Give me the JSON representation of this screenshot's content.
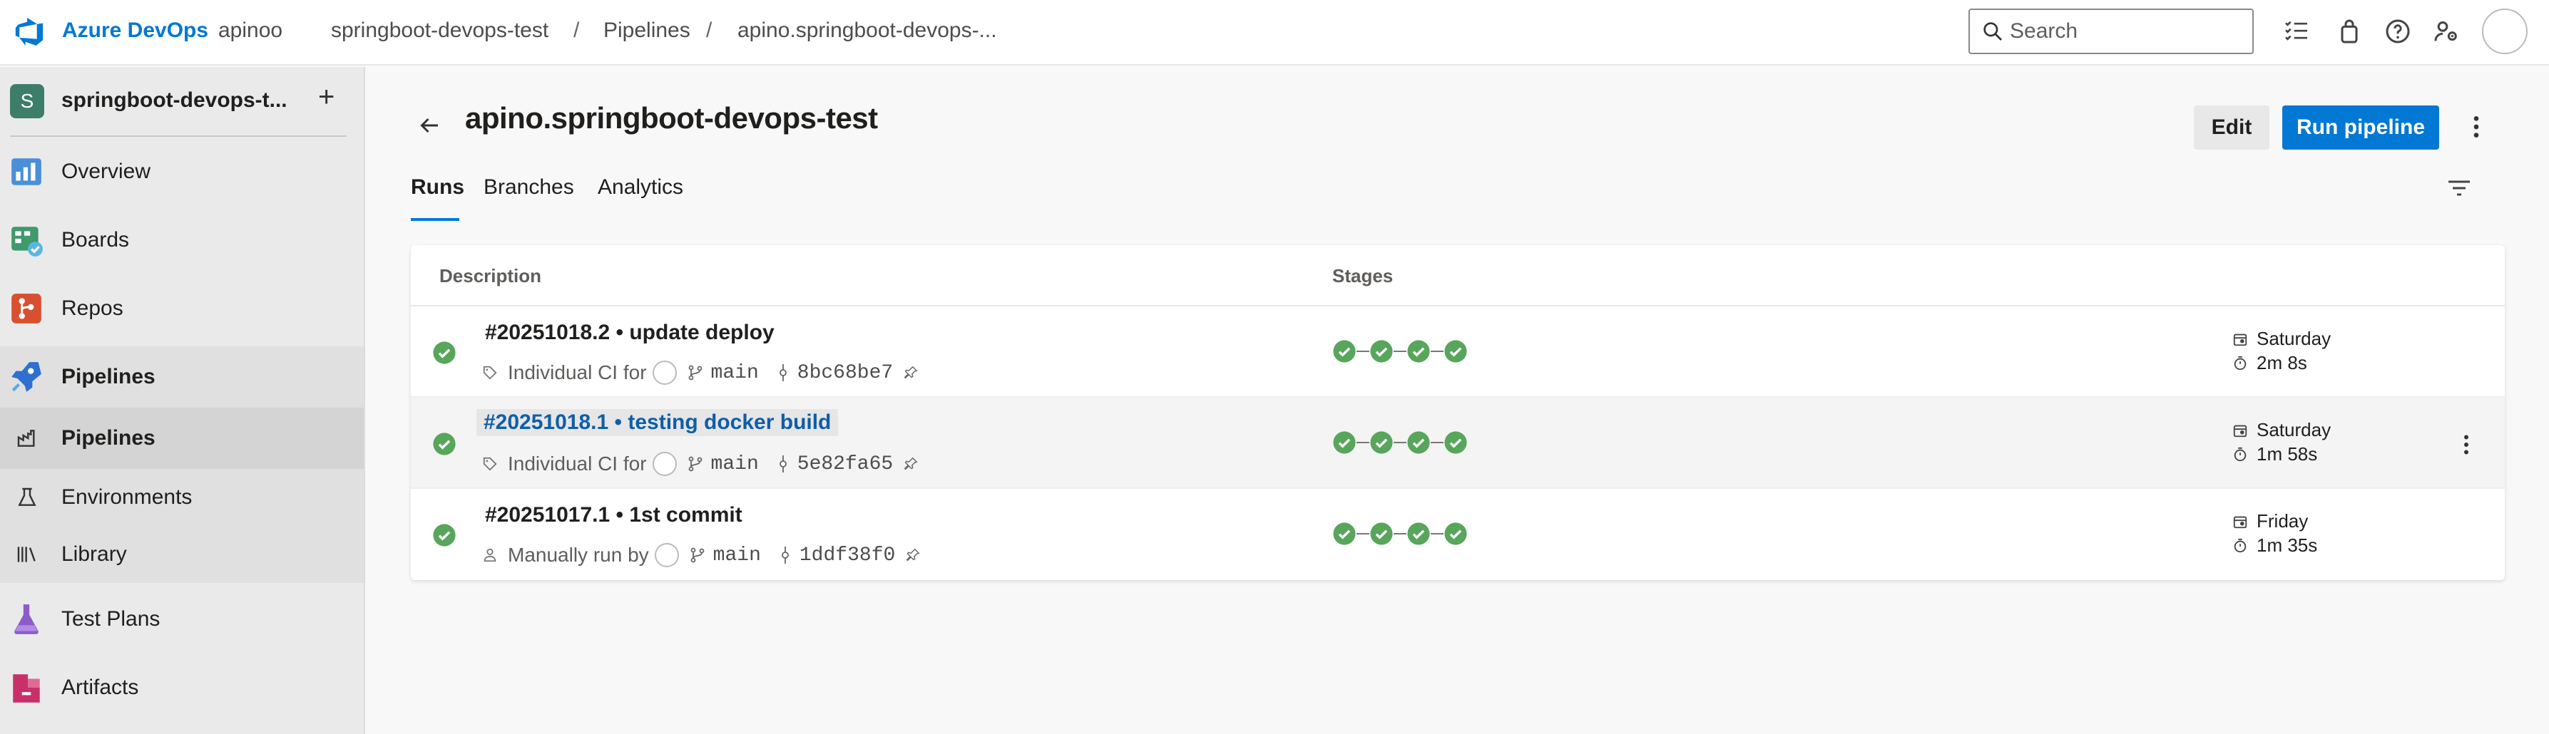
{
  "topbar": {
    "brand": "Azure DevOps",
    "breadcrumbs": [
      "apinoo",
      "springboot-devops-test",
      "Pipelines",
      "apino.springboot-devops-..."
    ],
    "separator": "/",
    "search_placeholder": "Search",
    "icons": [
      "task-list-icon",
      "shopping-bag-icon",
      "help-icon",
      "user-settings-icon"
    ]
  },
  "sidebar": {
    "project_initial": "S",
    "project_name": "springboot-devops-t...",
    "add_label": "+",
    "items": [
      {
        "label": "Overview",
        "icon": "overview-icon"
      },
      {
        "label": "Boards",
        "icon": "boards-icon"
      },
      {
        "label": "Repos",
        "icon": "repos-icon"
      },
      {
        "label": "Pipelines",
        "icon": "pipelines-icon"
      },
      {
        "label": "Pipelines",
        "icon": "pipelines-sub-icon"
      },
      {
        "label": "Environments",
        "icon": "environments-icon"
      },
      {
        "label": "Library",
        "icon": "library-icon"
      },
      {
        "label": "Test Plans",
        "icon": "test-plans-icon"
      },
      {
        "label": "Artifacts",
        "icon": "artifacts-icon"
      }
    ]
  },
  "main": {
    "title": "apino.springboot-devops-test",
    "edit_label": "Edit",
    "run_label": "Run pipeline",
    "tabs": [
      "Runs",
      "Branches",
      "Analytics"
    ],
    "active_tab": "Runs",
    "columns": {
      "description": "Description",
      "stages": "Stages"
    },
    "runs": [
      {
        "title": "#20251018.2 • update deploy",
        "trigger": "Individual CI for",
        "branch": "main",
        "commit": "8bc68be7",
        "date": "Saturday",
        "duration": "2m 8s",
        "status": "succeeded",
        "stages": 4
      },
      {
        "title": "#20251018.1 • testing docker build",
        "trigger": "Individual CI for",
        "branch": "main",
        "commit": "5e82fa65",
        "date": "Saturday",
        "duration": "1m 58s",
        "status": "succeeded",
        "stages": 4
      },
      {
        "title": "#20251017.1 • 1st commit",
        "trigger": "Manually run by",
        "branch": "main",
        "commit": "1ddf38f0",
        "date": "Friday",
        "duration": "1m 35s",
        "status": "succeeded",
        "stages": 4
      }
    ]
  },
  "colors": {
    "accent": "#0078d4",
    "success": "#58a55c",
    "link": "#0f5ea8"
  }
}
